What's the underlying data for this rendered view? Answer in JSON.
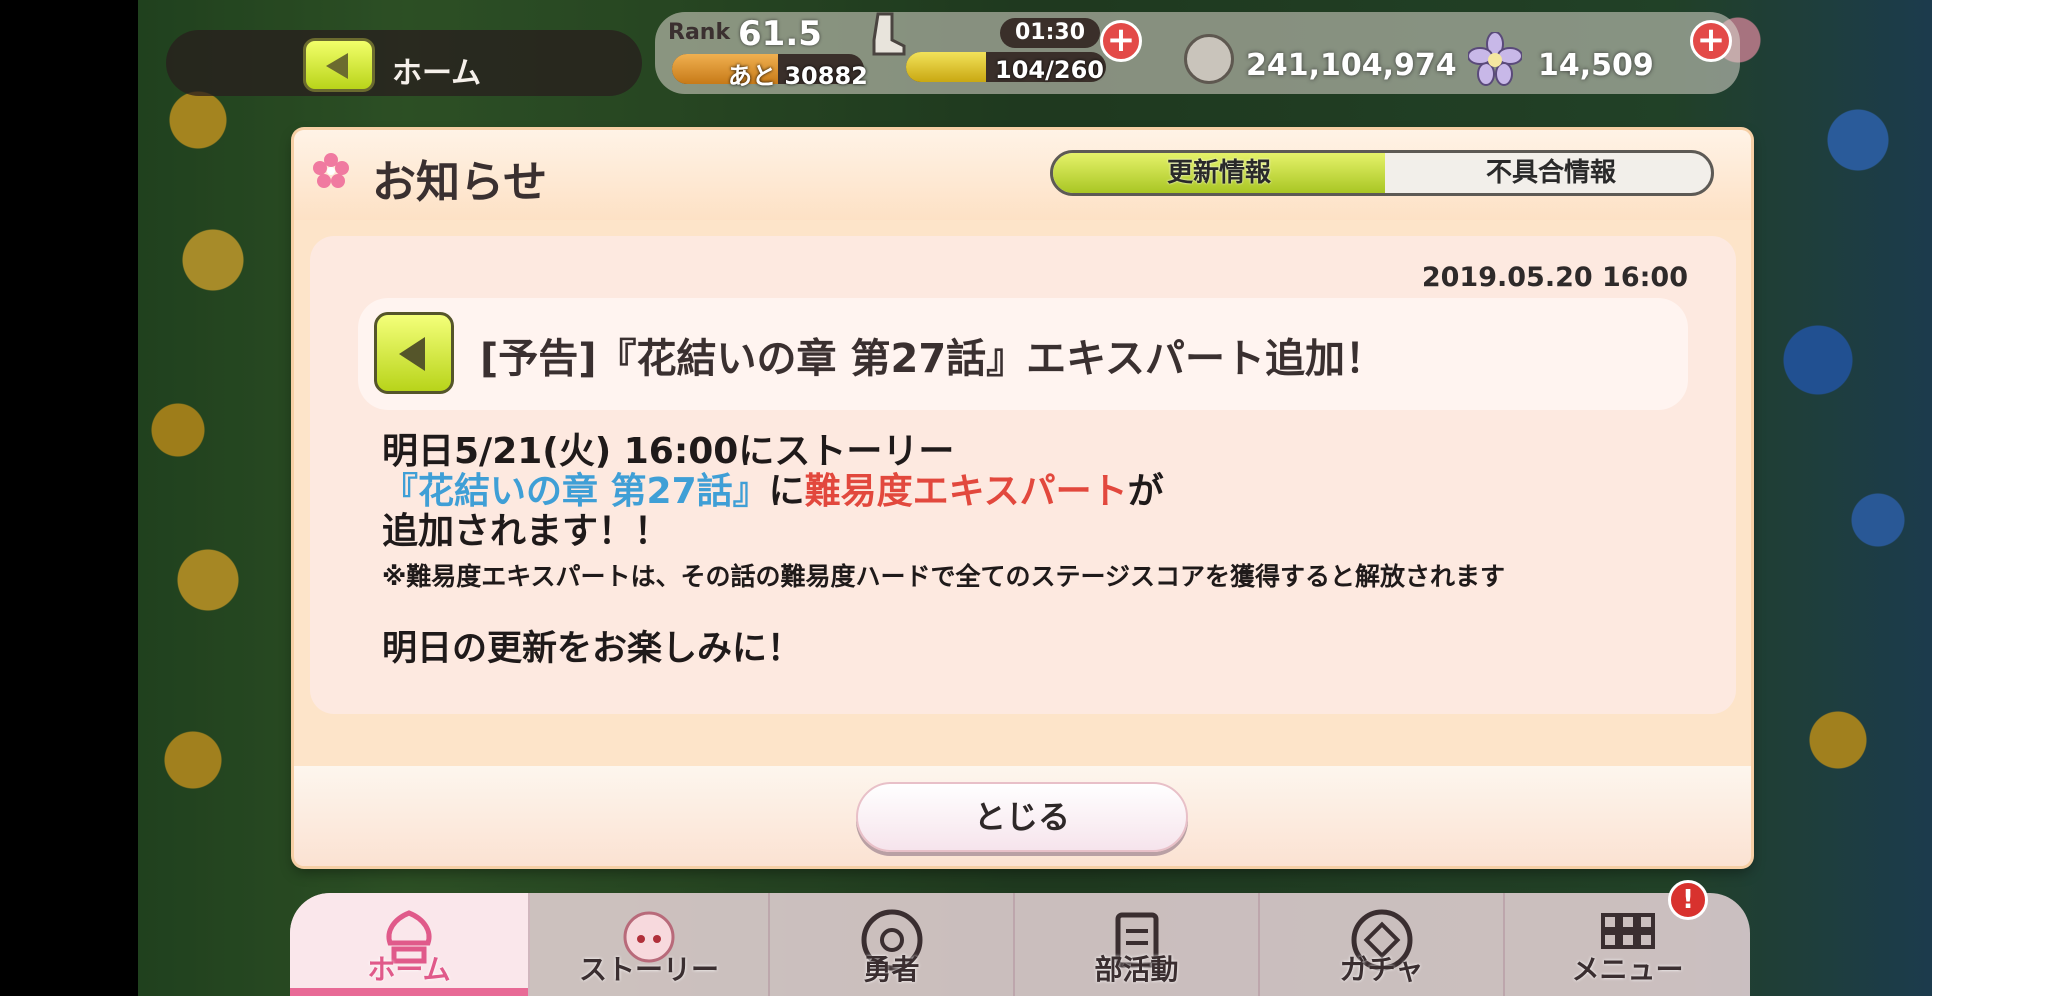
{
  "hud": {
    "home_label": "ホーム",
    "rank_label": "Rank",
    "rank_value": "61.5",
    "exp_remaining": "あと 30882",
    "exp_progress": 0.55,
    "stamina_timer": "01:30",
    "stamina": "104/260",
    "stamina_progress": 0.4,
    "coins": "241,104,974",
    "flowers": "14,509"
  },
  "dialog": {
    "title": "お知らせ",
    "tabs": [
      "更新情報",
      "不具合情報"
    ],
    "active_tab": "更新情報",
    "date": "2019.05.20 16:00",
    "headline": "[予告]『花結いの章 第27話』エキスパート追加！",
    "body": {
      "line1": "明日5/21(火) 16:00にストーリー",
      "line2_blue": "『花結いの章 第27話』",
      "line2_mid": "に",
      "line2_red": "難易度エキスパート",
      "line2_end": "が",
      "line3": "追加されます！！",
      "note": "※難易度エキスパートは、その話の難易度ハードで全てのステージスコアを獲得すると解放されます",
      "closing": "明日の更新をお楽しみに！"
    },
    "close_label": "とじる"
  },
  "nav": {
    "items": [
      "ホーム",
      "ストーリー",
      "勇者",
      "部活動",
      "ガチャ",
      "メニュー"
    ],
    "menu_badge": "!"
  },
  "colors": {
    "active_tab": "#c6dc38",
    "blue_text": "#3f9fd6",
    "red_text": "#e2483d",
    "dialog_bg": "#fde4c9"
  }
}
